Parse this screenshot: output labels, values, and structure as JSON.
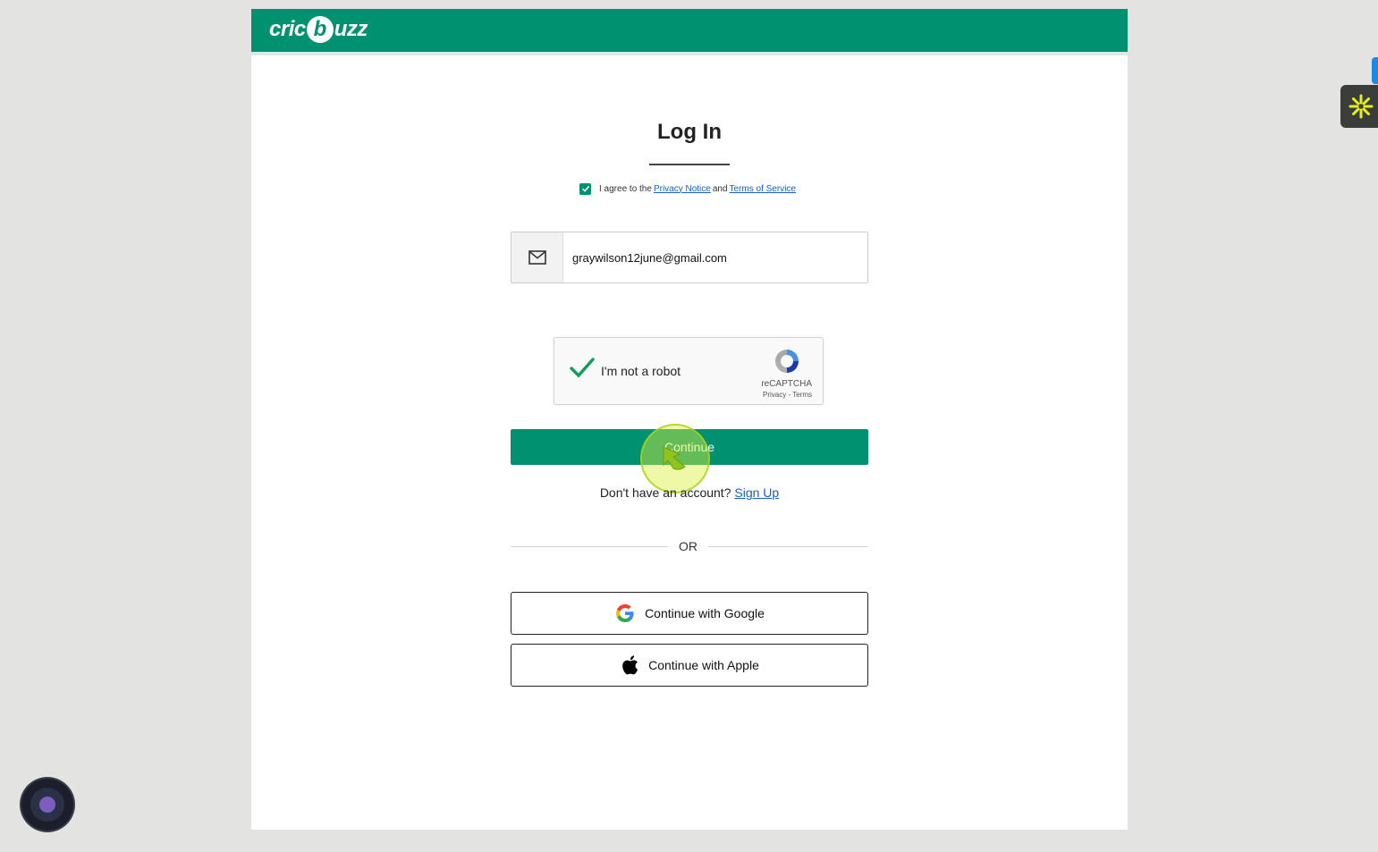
{
  "header": {
    "logo_prefix": "cric",
    "logo_ball": "b",
    "logo_suffix": "uzz",
    "brand_color": "#009270"
  },
  "login": {
    "title": "Log In",
    "agree_text": "I agree to the",
    "privacy_link": "Privacy Notice",
    "and_text": "and",
    "terms_link": "Terms of Service",
    "agree_checked": true
  },
  "email": {
    "icon": "mail-icon",
    "value": "graywilson12june@gmail.com"
  },
  "recaptcha": {
    "label": "I'm not a robot",
    "checked": true,
    "brand": "reCAPTCHA",
    "links": "Privacy - Terms"
  },
  "actions": {
    "continue_label": "Continue",
    "no_account_text": "Don't have an account?",
    "signup_link": "Sign Up",
    "or_text": "OR",
    "google_label": "Continue with Google",
    "apple_label": "Continue with Apple"
  },
  "icons": {
    "side_widget": "asterisk-icon",
    "bubble": "assistant-bubble-icon"
  }
}
